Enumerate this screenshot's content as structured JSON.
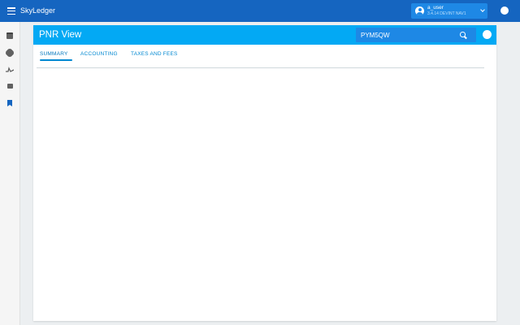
{
  "app": {
    "name": "SkyLedger"
  },
  "user": {
    "name": "a_user",
    "environment": "3.4.14 DEVINT NAV1"
  },
  "rail": {
    "items": [
      {
        "icon": "calendar-icon"
      },
      {
        "icon": "gear-icon"
      },
      {
        "icon": "flow-icon"
      },
      {
        "icon": "book-icon"
      },
      {
        "icon": "bookmark-icon",
        "active": true
      }
    ]
  },
  "page": {
    "title": "PNR View",
    "search": {
      "value": "PYM5QW",
      "placeholder": ""
    },
    "tabs": [
      {
        "label": "SUMMARY",
        "active": true
      },
      {
        "label": "ACCOUNTING",
        "active": false
      },
      {
        "label": "TAXES AND FEES",
        "active": false
      }
    ]
  },
  "colors": {
    "app_bar": "#1565c0",
    "header": "#03a9f4",
    "accent": "#0288d1"
  }
}
